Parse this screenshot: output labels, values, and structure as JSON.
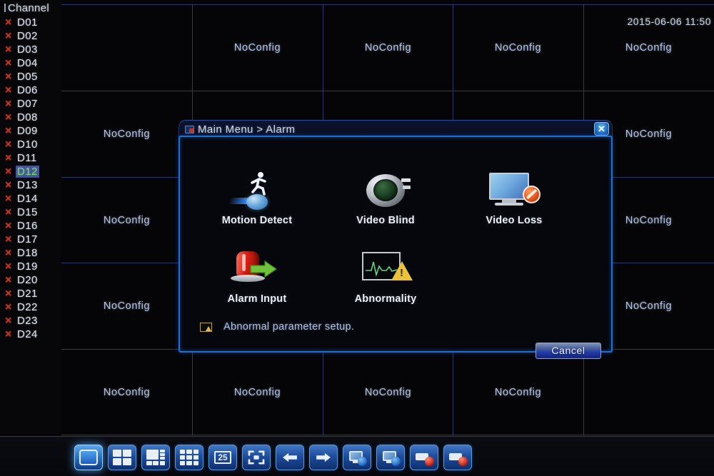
{
  "timestamp": "2015-06-06 11:50",
  "channel_panel": {
    "header": "Channel",
    "channels": [
      {
        "label": "D01",
        "status_icon": "red-x-icon",
        "selected": false
      },
      {
        "label": "D02",
        "status_icon": "red-x-icon",
        "selected": false
      },
      {
        "label": "D03",
        "status_icon": "red-x-icon",
        "selected": false
      },
      {
        "label": "D04",
        "status_icon": "red-x-icon",
        "selected": false
      },
      {
        "label": "D05",
        "status_icon": "red-x-icon",
        "selected": false
      },
      {
        "label": "D06",
        "status_icon": "red-x-icon",
        "selected": false
      },
      {
        "label": "D07",
        "status_icon": "red-x-icon",
        "selected": false
      },
      {
        "label": "D08",
        "status_icon": "red-x-icon",
        "selected": false
      },
      {
        "label": "D09",
        "status_icon": "red-x-icon",
        "selected": false
      },
      {
        "label": "D10",
        "status_icon": "red-x-icon",
        "selected": false
      },
      {
        "label": "D11",
        "status_icon": "red-x-icon",
        "selected": false
      },
      {
        "label": "D12",
        "status_icon": "red-x-icon",
        "selected": true
      },
      {
        "label": "D13",
        "status_icon": "red-x-icon",
        "selected": false
      },
      {
        "label": "D14",
        "status_icon": "red-x-icon",
        "selected": false
      },
      {
        "label": "D15",
        "status_icon": "red-x-icon",
        "selected": false
      },
      {
        "label": "D16",
        "status_icon": "red-x-icon",
        "selected": false
      },
      {
        "label": "D17",
        "status_icon": "red-x-icon",
        "selected": false
      },
      {
        "label": "D18",
        "status_icon": "red-x-icon",
        "selected": false
      },
      {
        "label": "D19",
        "status_icon": "red-x-icon",
        "selected": false
      },
      {
        "label": "D20",
        "status_icon": "red-x-icon",
        "selected": false
      },
      {
        "label": "D21",
        "status_icon": "red-x-icon",
        "selected": false
      },
      {
        "label": "D22",
        "status_icon": "red-x-icon",
        "selected": false
      },
      {
        "label": "D23",
        "status_icon": "red-x-icon",
        "selected": false
      },
      {
        "label": "D24",
        "status_icon": "red-x-icon",
        "selected": false
      }
    ],
    "x_glyph": "×"
  },
  "video_wall": {
    "columns": 5,
    "rows": 5,
    "no_config_label": "NoConfig",
    "cells": [
      {
        "row": 0,
        "col": 0,
        "label": ""
      },
      {
        "row": 0,
        "col": 1,
        "label": "NoConfig"
      },
      {
        "row": 0,
        "col": 2,
        "label": "NoConfig"
      },
      {
        "row": 0,
        "col": 3,
        "label": "NoConfig"
      },
      {
        "row": 0,
        "col": 4,
        "label": "NoConfig"
      },
      {
        "row": 1,
        "col": 0,
        "label": "NoConfig"
      },
      {
        "row": 1,
        "col": 4,
        "label": "NoConfig"
      },
      {
        "row": 2,
        "col": 0,
        "label": "NoConfig"
      },
      {
        "row": 2,
        "col": 4,
        "label": "NoConfig"
      },
      {
        "row": 3,
        "col": 0,
        "label": "NoConfig"
      },
      {
        "row": 3,
        "col": 4,
        "label": "NoConfig"
      },
      {
        "row": 4,
        "col": 0,
        "label": "NoConfig"
      },
      {
        "row": 4,
        "col": 1,
        "label": "NoConfig"
      },
      {
        "row": 4,
        "col": 2,
        "label": "NoConfig"
      },
      {
        "row": 4,
        "col": 3,
        "label": "NoConfig"
      }
    ]
  },
  "dialog": {
    "title": "Main Menu > Alarm",
    "title_icon": "window-icon",
    "close_icon": "close-icon",
    "close_glyph": "✕",
    "items": [
      {
        "label": "Motion Detect",
        "icon": "motion-detect-icon"
      },
      {
        "label": "Video Blind",
        "icon": "video-blind-icon"
      },
      {
        "label": "Video Loss",
        "icon": "video-loss-icon"
      },
      {
        "label": "Alarm Input",
        "icon": "alarm-input-icon"
      },
      {
        "label": "Abnormality",
        "icon": "abnormality-icon"
      }
    ],
    "hint": {
      "icon": "abnormality-small-icon",
      "text": "Abnormal parameter setup."
    },
    "cancel_label": "Cancel"
  },
  "bottom_toolbar": {
    "buttons": [
      {
        "name": "view-single",
        "icon": "single-pane-icon",
        "active": true
      },
      {
        "name": "view-quad",
        "icon": "four-pane-icon",
        "active": false
      },
      {
        "name": "view-six",
        "icon": "six-pane-icon",
        "active": false
      },
      {
        "name": "view-nine",
        "icon": "nine-pane-icon",
        "active": false
      },
      {
        "name": "view-25",
        "icon": "twentyfive-pane-icon",
        "label": "25",
        "active": false
      },
      {
        "name": "view-fullscreen",
        "icon": "fullscreen-icon",
        "active": false
      },
      {
        "name": "prev-page",
        "icon": "arrow-left-icon",
        "active": false
      },
      {
        "name": "next-page",
        "icon": "arrow-right-icon",
        "active": false
      },
      {
        "name": "monitor-start",
        "icon": "monitor-play-icon",
        "active": false
      },
      {
        "name": "monitor-stop",
        "icon": "monitor-stop-icon",
        "active": false
      },
      {
        "name": "record-start",
        "icon": "record-play-icon",
        "active": false
      },
      {
        "name": "record-stop",
        "icon": "record-stop-icon",
        "active": false
      }
    ]
  },
  "colors": {
    "grid_line": "#3a3f7a",
    "dialog_border": "#1d6fd8",
    "accent_blue": "#2a74cd",
    "channel_x_red": "#c0392b",
    "selected_text_green": "#6fe07a",
    "selected_bg": "#4a4f96"
  }
}
